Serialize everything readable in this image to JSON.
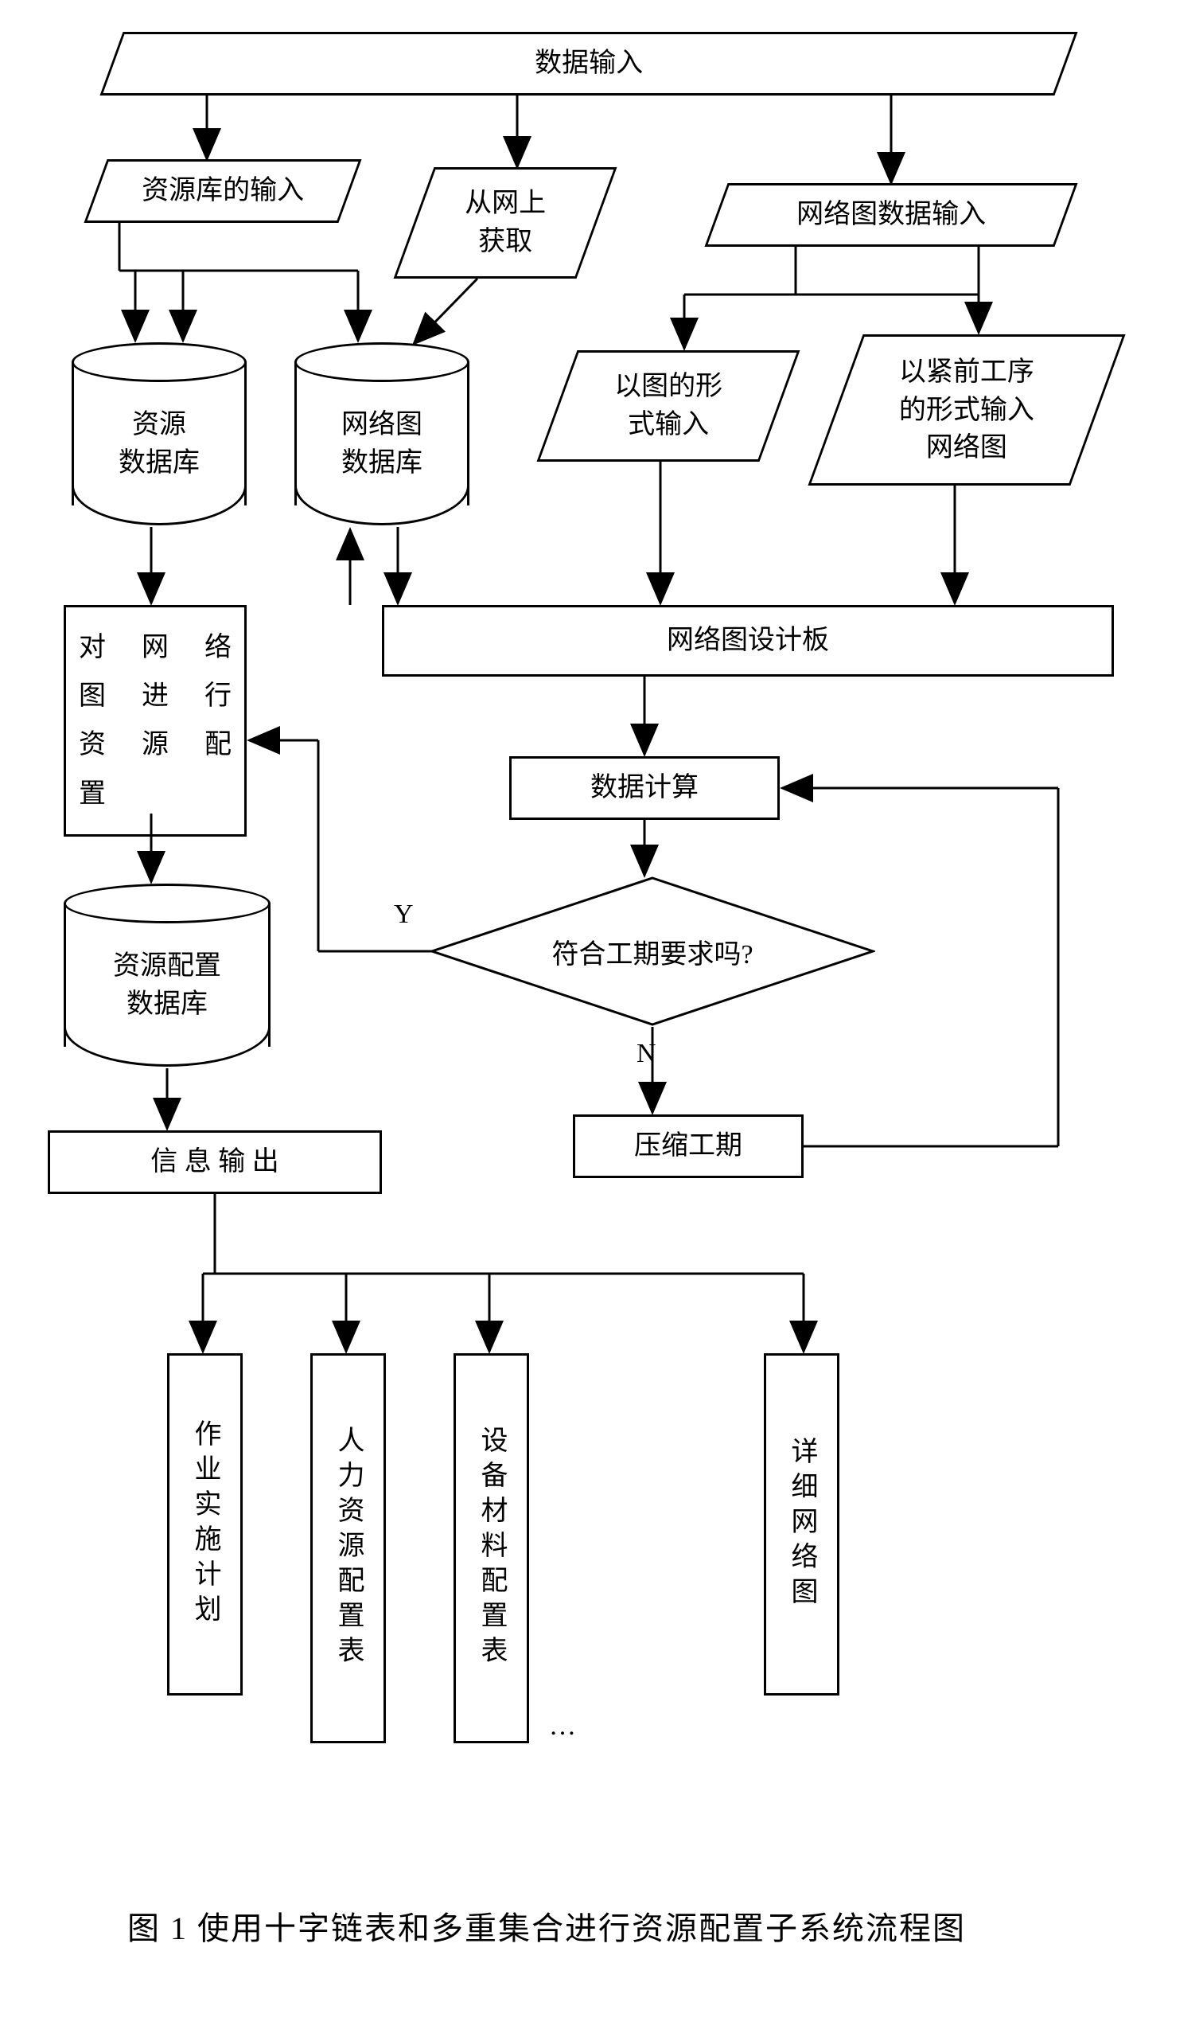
{
  "top": {
    "title": "数据输入"
  },
  "row2": {
    "resLibInput": "资源库的输入",
    "fromWeb": "从网上\n获取",
    "netInput": "网络图数据输入"
  },
  "row3": {
    "graphForm": "以图的形\n式输入",
    "predForm": "以紧前工序\n的形式输入\n网络图"
  },
  "dbs": {
    "resDb": "资源\n数据库",
    "netDb": "网络图\n数据库",
    "cfgDb": "资源配置\n数据库"
  },
  "blocks": {
    "configure": [
      "对 网 络",
      "图 进 行",
      "资 源 配",
      "置"
    ],
    "designBoard": "网络图设计板",
    "calc": "数据计算",
    "compress": "压缩工期",
    "infoOut": "信 息 输 出"
  },
  "decision": {
    "question": "符合工期要求吗?",
    "yes": "Y",
    "no": "N"
  },
  "outputs": {
    "o1": "作业实施计划",
    "o2": "人力资源配置表",
    "o3": "设备材料配置表",
    "o4": "详细网络图",
    "dots": "…"
  },
  "caption": "图 1  使用十字链表和多重集合进行资源配置子系统流程图"
}
